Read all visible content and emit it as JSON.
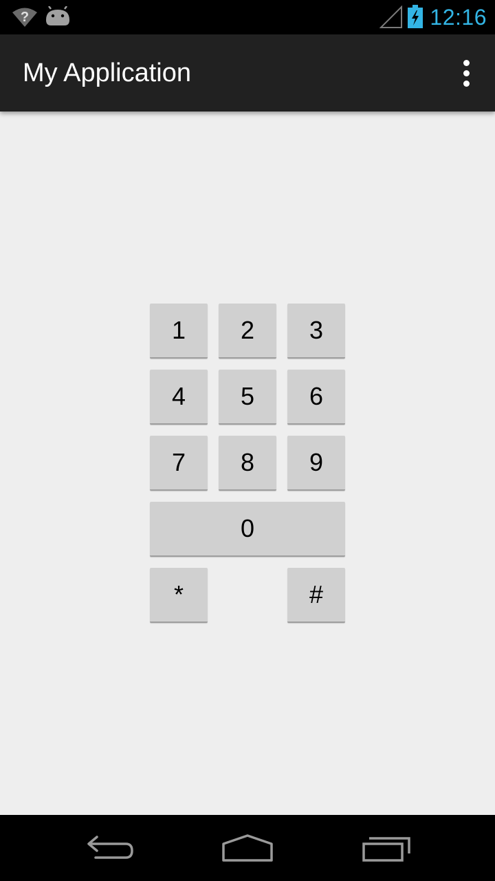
{
  "status_bar": {
    "time": "12:16",
    "icons": [
      "wifi-unknown-icon",
      "android-debug-icon",
      "signal-empty-icon",
      "battery-charging-icon"
    ],
    "clock_color": "#33b5e5"
  },
  "action_bar": {
    "title": "My Application",
    "overflow_icon": "overflow-menu-icon",
    "background": "#212121"
  },
  "keypad": {
    "keys": {
      "k1": "1",
      "k2": "2",
      "k3": "3",
      "k4": "4",
      "k5": "5",
      "k6": "6",
      "k7": "7",
      "k8": "8",
      "k9": "9",
      "k0": "0",
      "star": "*",
      "hash": "#"
    },
    "key_color": "#d0d0d0",
    "background": "#eeeeee"
  },
  "nav_bar": {
    "icons": [
      "back-icon",
      "home-icon",
      "recents-icon"
    ]
  }
}
